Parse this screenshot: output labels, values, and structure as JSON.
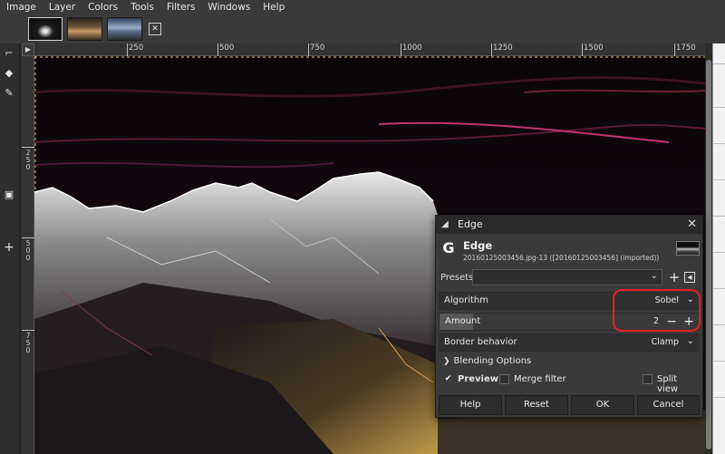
{
  "menu": [
    "Image",
    "Layer",
    "Colors",
    "Tools",
    "Filters",
    "Windows",
    "Help"
  ],
  "ruler": {
    "h_labels": [
      "250",
      "500",
      "750",
      "1000",
      "1250",
      "1500",
      "1750"
    ],
    "v_labels": [
      "2\n5\n0",
      "5\n0\n0",
      "7\n5\n0"
    ]
  },
  "dialog": {
    "title": "Edge",
    "header_title": "Edge",
    "header_subtitle": "20160125003456.jpg-13 ([20160125003456] (imported))",
    "presets_label": "Presets:",
    "presets_value": "",
    "algorithm_label": "Algorithm",
    "algorithm_value": "Sobel",
    "amount_label": "Amount",
    "amount_value": "2",
    "amount_fill_fraction": 0.13,
    "border_label": "Border behavior",
    "border_value": "Clamp",
    "blending_label": "Blending Options",
    "preview_label": "Preview",
    "preview_checked": true,
    "merge_label": "Merge filter",
    "merge_checked": false,
    "split_label": "Split view",
    "split_checked": false,
    "buttons": {
      "help": "Help",
      "reset": "Reset",
      "ok": "OK",
      "cancel": "Cancel"
    }
  },
  "colors": {
    "highlight": "#e3202a",
    "panel": "#3a3a3a",
    "canvas_dark": "#0b0608"
  }
}
